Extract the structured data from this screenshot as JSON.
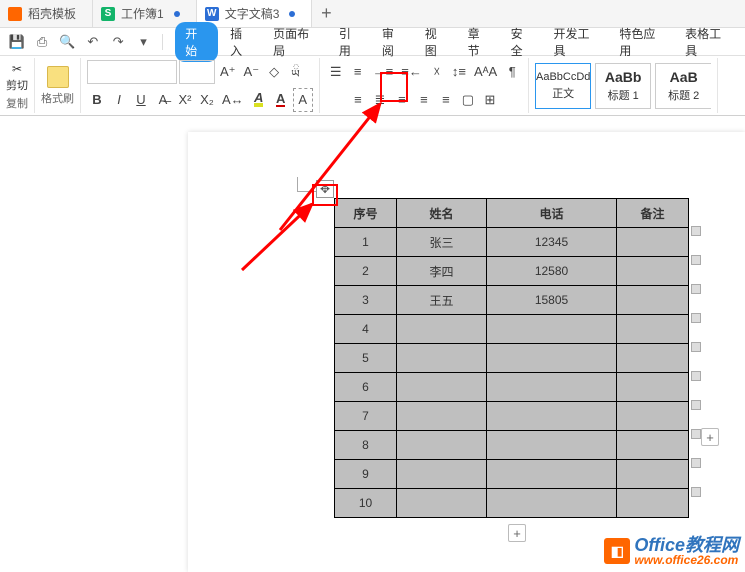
{
  "tabs": [
    {
      "label": "稻壳模板",
      "iconColor": "orange"
    },
    {
      "label": "工作簿1",
      "iconColor": "green"
    },
    {
      "label": "文字文稿3",
      "iconColor": "blue",
      "active": true
    }
  ],
  "tab_add": "+",
  "quick": {
    "cut": "剪切",
    "copy": "复制",
    "fmt": "格式刷"
  },
  "menu": {
    "start": "开始",
    "insert": "插入",
    "layout": "页面布局",
    "ref": "引用",
    "review": "审阅",
    "view": "视图",
    "chapter": "章节",
    "security": "安全",
    "dev": "开发工具",
    "special": "特色应用",
    "table_tools": "表格工具"
  },
  "font": {
    "bold": "B",
    "italic": "I",
    "underline": "U",
    "strike": "S",
    "a_plus": "A⁺",
    "a_minus": "A⁻",
    "sup": "X²",
    "sub": "X₂",
    "font_color": "A",
    "highlight": "A",
    "clear": "◇",
    "box_a": "A",
    "border_a": "A"
  },
  "styles": {
    "normal_preview": "AaBbCcDd",
    "normal_label": "正文",
    "h1_preview": "AaBb",
    "h1_label": "标题 1",
    "h2_preview": "AaB",
    "h2_label": "标题 2"
  },
  "table": {
    "headers": [
      "序号",
      "姓名",
      "电话",
      "备注"
    ],
    "rows": [
      {
        "no": "1",
        "name": "张三",
        "phone": "12345",
        "note": ""
      },
      {
        "no": "2",
        "name": "李四",
        "phone": "12580",
        "note": ""
      },
      {
        "no": "3",
        "name": "王五",
        "phone": "15805",
        "note": ""
      },
      {
        "no": "4",
        "name": "",
        "phone": "",
        "note": ""
      },
      {
        "no": "5",
        "name": "",
        "phone": "",
        "note": ""
      },
      {
        "no": "6",
        "name": "",
        "phone": "",
        "note": ""
      },
      {
        "no": "7",
        "name": "",
        "phone": "",
        "note": ""
      },
      {
        "no": "8",
        "name": "",
        "phone": "",
        "note": ""
      },
      {
        "no": "9",
        "name": "",
        "phone": "",
        "note": ""
      },
      {
        "no": "10",
        "name": "",
        "phone": "",
        "note": ""
      }
    ]
  },
  "move_handle": "✥",
  "plus": "+",
  "watermark": {
    "icon": "■",
    "main": "Office教程网",
    "sub": "www.office26.com"
  }
}
